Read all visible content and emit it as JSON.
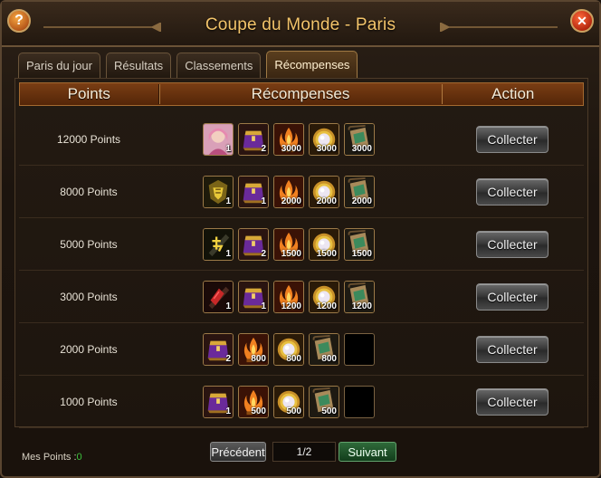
{
  "window": {
    "title": "Coupe du Monde - Paris",
    "help_label": "?",
    "close_label": "✕"
  },
  "tabs": [
    {
      "label": "Paris du jour",
      "active": false
    },
    {
      "label": "Résultats",
      "active": false
    },
    {
      "label": "Classements",
      "active": false
    },
    {
      "label": "Récompenses",
      "active": true
    }
  ],
  "table": {
    "headers": {
      "points": "Points",
      "rewards": "Récompenses",
      "action": "Action"
    },
    "rows": [
      {
        "points": "12000 Points",
        "rewards": [
          {
            "icon": "hero-portrait-icon",
            "qty": "1"
          },
          {
            "icon": "purple-chest-icon",
            "qty": "2"
          },
          {
            "icon": "fire-pillar-icon",
            "qty": "3000"
          },
          {
            "icon": "pearl-medallion-icon",
            "qty": "3000"
          },
          {
            "icon": "scroll-icon",
            "qty": "3000"
          }
        ],
        "action": "Collecter"
      },
      {
        "points": "8000 Points",
        "rewards": [
          {
            "icon": "gold-crest-icon",
            "qty": "1"
          },
          {
            "icon": "purple-chest-icon",
            "qty": "1"
          },
          {
            "icon": "fire-pillar-icon",
            "qty": "2000"
          },
          {
            "icon": "pearl-medallion-icon",
            "qty": "2000"
          },
          {
            "icon": "scroll-icon",
            "qty": "2000"
          }
        ],
        "action": "Collecter"
      },
      {
        "points": "5000 Points",
        "rewards": [
          {
            "icon": "gold-rune-icon",
            "qty": "1"
          },
          {
            "icon": "purple-chest-icon",
            "qty": "2"
          },
          {
            "icon": "fire-pillar-icon",
            "qty": "1500"
          },
          {
            "icon": "pearl-medallion-icon",
            "qty": "1500"
          },
          {
            "icon": "scroll-icon",
            "qty": "1500"
          }
        ],
        "action": "Collecter"
      },
      {
        "points": "3000 Points",
        "rewards": [
          {
            "icon": "red-rune-icon",
            "qty": "1"
          },
          {
            "icon": "purple-chest-icon",
            "qty": "1"
          },
          {
            "icon": "fire-pillar-icon",
            "qty": "1200"
          },
          {
            "icon": "pearl-medallion-icon",
            "qty": "1200"
          },
          {
            "icon": "scroll-icon",
            "qty": "1200"
          }
        ],
        "action": "Collecter"
      },
      {
        "points": "2000 Points",
        "rewards": [
          {
            "icon": "purple-chest-icon",
            "qty": "2"
          },
          {
            "icon": "fire-pillar-icon",
            "qty": "800"
          },
          {
            "icon": "pearl-medallion-icon",
            "qty": "800"
          },
          {
            "icon": "scroll-icon",
            "qty": "800"
          },
          {
            "icon": "empty-slot",
            "qty": ""
          }
        ],
        "action": "Collecter"
      },
      {
        "points": "1000 Points",
        "rewards": [
          {
            "icon": "purple-chest-icon",
            "qty": "1"
          },
          {
            "icon": "fire-pillar-icon",
            "qty": "500"
          },
          {
            "icon": "pearl-medallion-icon",
            "qty": "500"
          },
          {
            "icon": "scroll-icon",
            "qty": "500"
          },
          {
            "icon": "empty-slot",
            "qty": ""
          }
        ],
        "action": "Collecter"
      }
    ]
  },
  "footer": {
    "my_points_label": "Mes Points :",
    "my_points_value": "0",
    "prev_label": "Précédent",
    "page": "1/2",
    "next_label": "Suivant"
  },
  "colors": {
    "title": "#f3c46a",
    "header_bg": "#7a3e14",
    "points_value": "#3cc23c",
    "next_button": "#2f6a3a"
  }
}
